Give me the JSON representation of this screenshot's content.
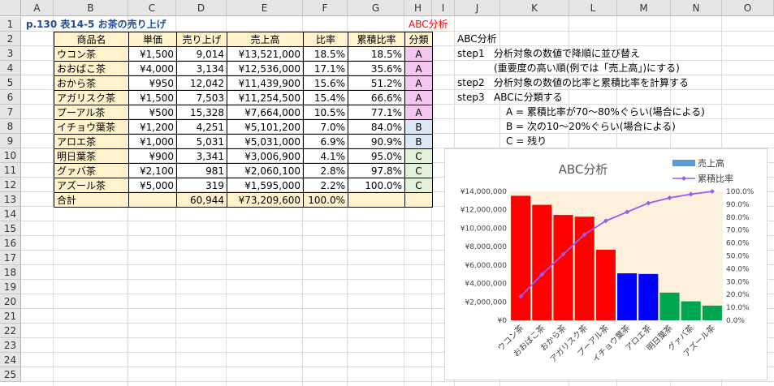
{
  "columns": [
    "A",
    "B",
    "C",
    "D",
    "E",
    "F",
    "G",
    "H",
    "I",
    "J",
    "K",
    "L",
    "M",
    "N",
    "O"
  ],
  "rows": [
    "1",
    "2",
    "3",
    "4",
    "5",
    "6",
    "7",
    "8",
    "9",
    "10",
    "11",
    "12",
    "13",
    "14",
    "15",
    "16",
    "17",
    "18",
    "19",
    "20",
    "21",
    "22",
    "23",
    "24",
    "25"
  ],
  "sheet_title": "p.130 表14-5 お茶の売り上げ",
  "abc_label": "ABC分析",
  "table": {
    "headers": [
      "商品名",
      "単価",
      "売り上げ",
      "売上高",
      "比率",
      "累積比率",
      "分類"
    ],
    "rows": [
      [
        "ウコン茶",
        "¥1,500",
        "9,014",
        "¥13,521,000",
        "18.5%",
        "18.5%",
        "A"
      ],
      [
        "おおばこ茶",
        "¥4,000",
        "3,134",
        "¥12,536,000",
        "17.1%",
        "35.6%",
        "A"
      ],
      [
        "おから茶",
        "¥950",
        "12,042",
        "¥11,439,900",
        "15.6%",
        "51.2%",
        "A"
      ],
      [
        "アガリスク茶",
        "¥1,500",
        "7,503",
        "¥11,254,500",
        "15.4%",
        "66.6%",
        "A"
      ],
      [
        "プーアル茶",
        "¥500",
        "15,328",
        "¥7,664,000",
        "10.5%",
        "77.1%",
        "A"
      ],
      [
        "イチョウ葉茶",
        "¥1,200",
        "4,251",
        "¥5,101,200",
        "7.0%",
        "84.0%",
        "B"
      ],
      [
        "アロエ茶",
        "¥1,000",
        "5,031",
        "¥5,031,000",
        "6.9%",
        "90.9%",
        "B"
      ],
      [
        "明日葉茶",
        "¥900",
        "3,341",
        "¥3,006,900",
        "4.1%",
        "95.0%",
        "C"
      ],
      [
        "グァバ茶",
        "¥2,100",
        "981",
        "¥2,060,100",
        "2.8%",
        "97.8%",
        "C"
      ],
      [
        "アズール茶",
        "¥5,000",
        "319",
        "¥1,595,000",
        "2.2%",
        "100.0%",
        "C"
      ]
    ],
    "total": [
      "合計",
      "",
      "60,944",
      "¥73,209,600",
      "100.0%",
      "",
      ""
    ]
  },
  "notes": {
    "heading": "ABC分析",
    "step1_label": "step1",
    "step1_text": "分析対象の数値で降順に並び替え",
    "step1_sub": "(重要度の高い順(例では「売上高」)にする)",
    "step2_label": "step2",
    "step2_text": "分析対象の数値の比率と累積比率を計算する",
    "step3_label": "step3",
    "step3_text": "ABCに分類する",
    "classA": "A = 累積比率が70～80%ぐらい(場合による)",
    "classB": "B = 次の10～20%ぐらい(場合による)",
    "classC": "C = 残り"
  },
  "colors": {
    "A": "#ff0000",
    "B": "#0000ff",
    "C": "#00a550",
    "line": "#9b59f0",
    "legend_bar": "#5b9bd5"
  },
  "chart_data": {
    "type": "bar",
    "title": "ABC分析",
    "categories": [
      "ウコン茶",
      "おおばこ茶",
      "おから茶",
      "アガリスク茶",
      "プーアル茶",
      "イチョウ葉茶",
      "アロエ茶",
      "明日葉茶",
      "グァバ茶",
      "アズール茶"
    ],
    "series": [
      {
        "name": "売上高",
        "type": "bar",
        "axis": "left",
        "values": [
          13521000,
          12536000,
          11439900,
          11254500,
          7664000,
          5101200,
          5031000,
          3006900,
          2060100,
          1595000
        ]
      },
      {
        "name": "累積比率",
        "type": "line",
        "axis": "right",
        "values": [
          18.5,
          35.6,
          51.2,
          66.6,
          77.1,
          84.0,
          90.9,
          95.0,
          97.8,
          100.0
        ]
      }
    ],
    "classes": [
      "A",
      "A",
      "A",
      "A",
      "A",
      "B",
      "B",
      "C",
      "C",
      "C"
    ],
    "ylim": [
      0,
      14000000
    ],
    "ylim_right": [
      0,
      100
    ],
    "y_ticks": [
      "¥0",
      "¥2,000,000",
      "¥4,000,000",
      "¥6,000,000",
      "¥8,000,000",
      "¥10,000,000",
      "¥12,000,000",
      "¥14,000,000"
    ],
    "y2_ticks": [
      "0.0%",
      "10.0%",
      "20.0%",
      "30.0%",
      "40.0%",
      "50.0%",
      "60.0%",
      "70.0%",
      "80.0%",
      "90.0%",
      "100.0%"
    ],
    "legend": "top-right"
  }
}
